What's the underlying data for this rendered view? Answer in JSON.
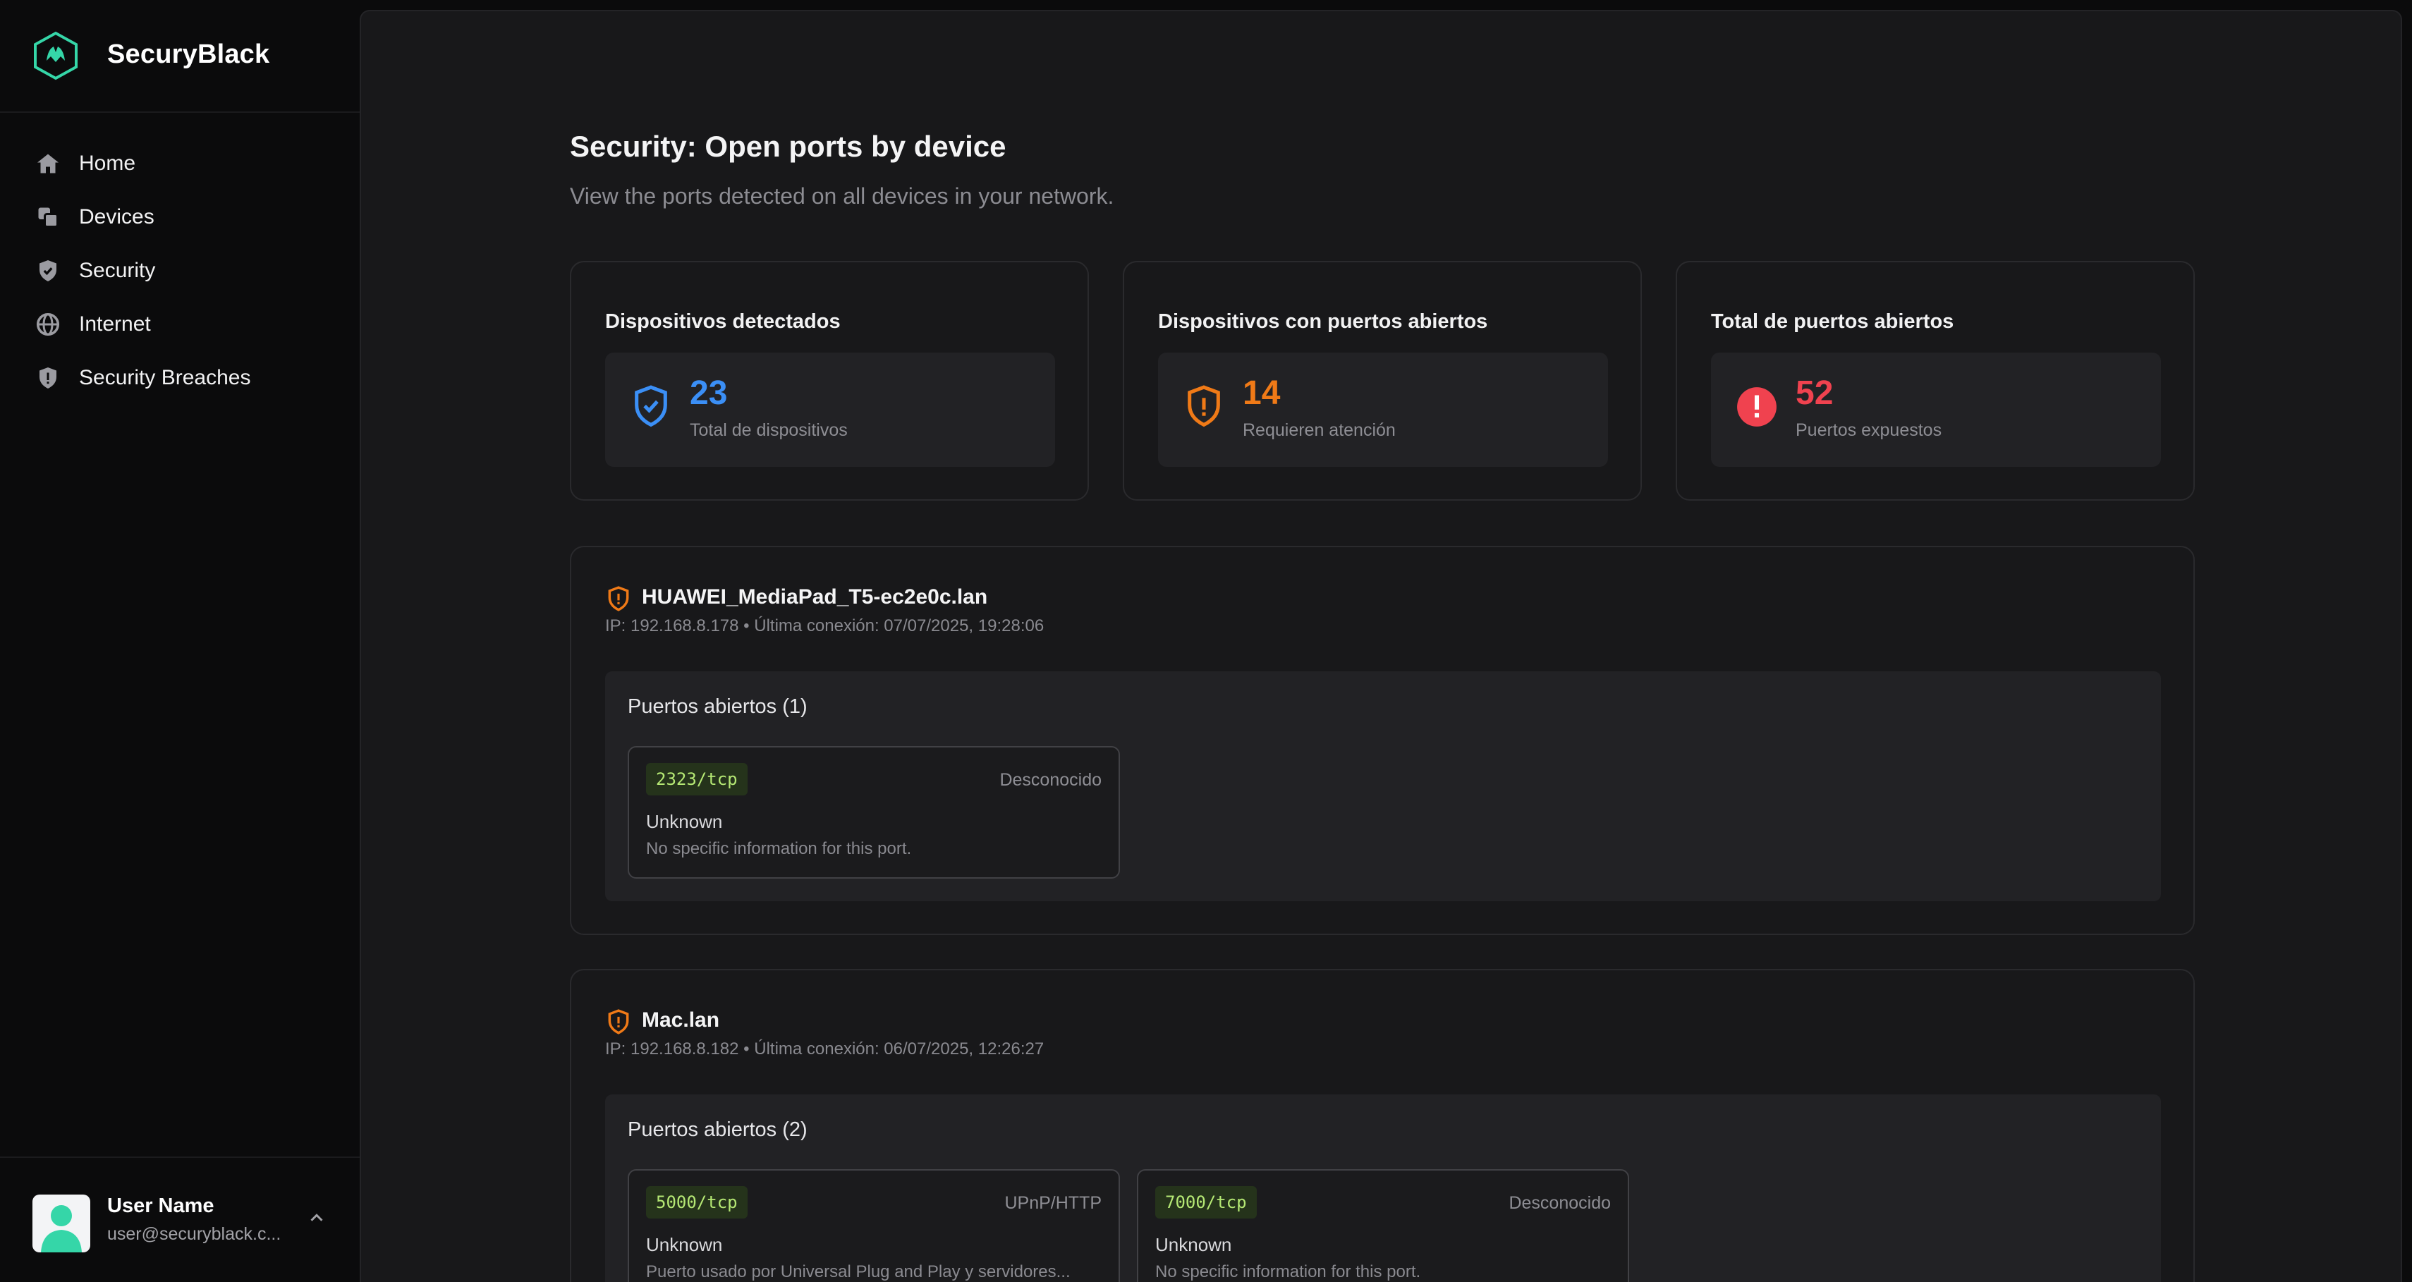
{
  "app": {
    "name": "SecuryBlack"
  },
  "nav": [
    {
      "label": "Home",
      "icon": "home-icon"
    },
    {
      "label": "Devices",
      "icon": "devices-icon"
    },
    {
      "label": "Security",
      "icon": "shield-check-icon"
    },
    {
      "label": "Internet",
      "icon": "globe-icon"
    },
    {
      "label": "Security Breaches",
      "icon": "shield-alert-icon"
    }
  ],
  "user": {
    "name": "User Name",
    "email": "user@securyblack.c..."
  },
  "page": {
    "title": "Security: Open ports by device",
    "subtitle": "View the ports detected on all devices in your network."
  },
  "stats": [
    {
      "title": "Dispositivos detectados",
      "value": "23",
      "caption": "Total de dispositivos",
      "color": "#3b8ff6",
      "icon": "shield-check-icon"
    },
    {
      "title": "Dispositivos con puertos abiertos",
      "value": "14",
      "caption": "Requieren atención",
      "color": "#f07a17",
      "icon": "shield-alert-icon"
    },
    {
      "title": "Total de puertos abiertos",
      "value": "52",
      "caption": "Puertos expuestos",
      "color": "#f0424f",
      "icon": "alert-circle-icon"
    }
  ],
  "devices": [
    {
      "name": "HUAWEI_MediaPad_T5-ec2e0c.lan",
      "meta": "IP: 192.168.8.178 • Última conexión: 07/07/2025, 19:28:06",
      "ports_title": "Puertos abiertos (1)",
      "ports": [
        {
          "port": "2323/tcp",
          "service": "Desconocido",
          "name": "Unknown",
          "description": "No specific information for this port."
        }
      ]
    },
    {
      "name": "Mac.lan",
      "meta": "IP: 192.168.8.182 • Última conexión: 06/07/2025, 12:26:27",
      "ports_title": "Puertos abiertos (2)",
      "ports": [
        {
          "port": "5000/tcp",
          "service": "UPnP/HTTP",
          "name": "Unknown",
          "description": "Puerto usado por Universal Plug and Play y servidores..."
        },
        {
          "port": "7000/tcp",
          "service": "Desconocido",
          "name": "Unknown",
          "description": "No specific information for this port."
        }
      ]
    }
  ],
  "colors": {
    "accent": "#35d6a8",
    "warning": "#f07a17",
    "danger": "#f0424f",
    "info": "#3b8ff6",
    "port_tag": "#b5e874"
  }
}
